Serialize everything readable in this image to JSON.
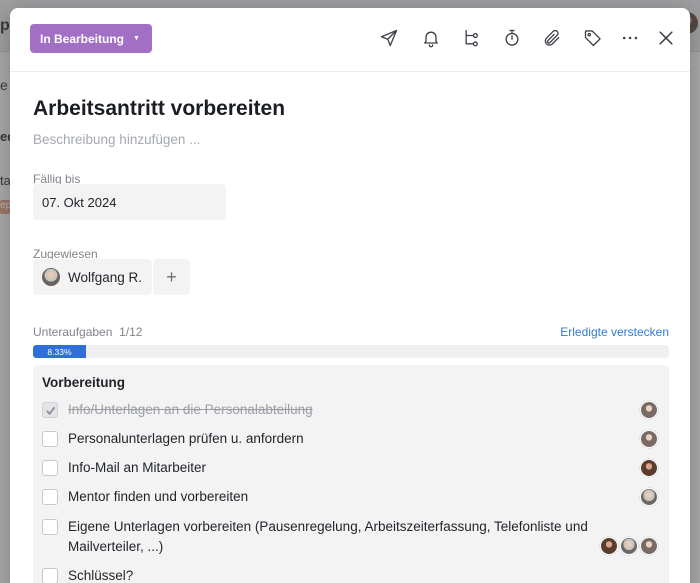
{
  "background": {
    "fragment_1": "p",
    "fragment_2": "e A",
    "fragment_3": "ed",
    "fragment_4": "ta",
    "fragment_5": "ep"
  },
  "header": {
    "status_label": "In Bearbeitung",
    "status_color": "#a26fc4",
    "tools": [
      "send-icon",
      "bell-icon",
      "subtask-tree-icon",
      "stopwatch-icon",
      "paperclip-icon",
      "tag-icon",
      "more-icon",
      "close-icon"
    ]
  },
  "task": {
    "title": "Arbeitsantritt vorbereiten",
    "description_placeholder": "Beschreibung hinzufügen ..."
  },
  "due": {
    "label": "Fällig bis",
    "value": "07. Okt 2024"
  },
  "assigned": {
    "label": "Zugewiesen",
    "name": "Wolfgang R.",
    "add_label": "+"
  },
  "subtasks": {
    "label": "Unteraufgaben",
    "count": "1/12",
    "hide_done_link": "Erledigte verstecken",
    "progress_label": "8.33%",
    "progress_fraction": 0.0833,
    "group_title": "Vorbereitung",
    "items": [
      {
        "text": "Info/Unterlagen an die Personalabteilung",
        "done": true
      },
      {
        "text": "Personalunterlagen prüfen u. anfordern",
        "done": false
      },
      {
        "text": "Info-Mail an Mitarbeiter",
        "done": false
      },
      {
        "text": "Mentor finden und vorbereiten",
        "done": false
      },
      {
        "text": "Eigene Unterlagen vorbereiten (Pausenregelung, Arbeitszeiterfassung, Telefonliste und Mailverteiler, ...)",
        "done": false
      },
      {
        "text": "Schlüssel?",
        "done": false
      }
    ]
  }
}
